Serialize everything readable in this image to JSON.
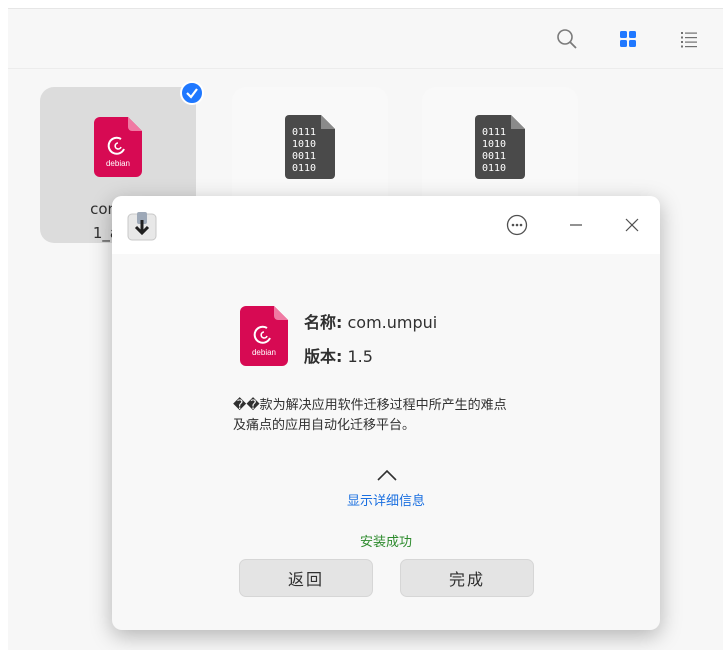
{
  "file_manager": {
    "toolbar": {
      "search_icon": "search-icon",
      "grid_view_icon": "grid-view-icon",
      "list_view_icon": "list-view-icon",
      "accent": "#1f78ff"
    },
    "files": [
      {
        "name_line1": "com.un",
        "name_line2": "1_amd",
        "selected": true,
        "icon": "debian-package-icon"
      },
      {
        "name_line1": "",
        "name_line2": "",
        "selected": false,
        "icon": "binary-file-icon"
      },
      {
        "name_line1": "",
        "name_line2": "",
        "selected": false,
        "icon": "binary-file-icon"
      }
    ]
  },
  "dialog": {
    "app_icon": "package-installer-icon",
    "menu_icon": "more-options-icon",
    "minimize_icon": "minimize-icon",
    "close_icon": "close-icon",
    "package": {
      "icon_label": "debian",
      "name_label": "名称:",
      "name_value": "com.umpui",
      "version_label": "版本:",
      "version_value": "1.5"
    },
    "description_line1": "��款为解决应用软件迁移过程中所产生的难点",
    "description_line2": "及痛点的应用自动化迁移平台。",
    "show_details": "显示详细信息",
    "status": "安装成功",
    "back_button": "返回",
    "done_button": "完成",
    "colors": {
      "link": "#1a6fe0",
      "success": "#2e8b2e",
      "debian_pink": "#d70a53"
    }
  }
}
